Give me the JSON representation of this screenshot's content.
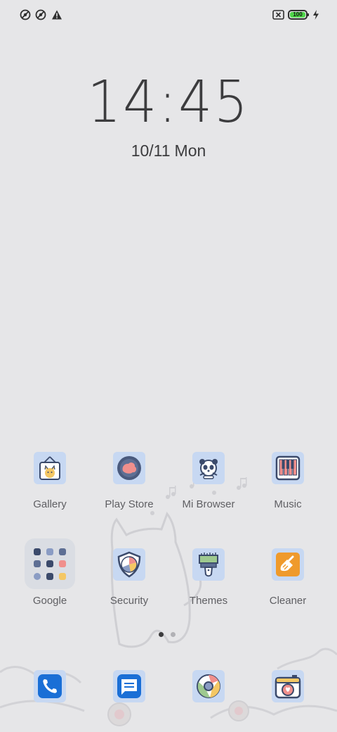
{
  "clock": {
    "time": "14:45"
  },
  "date": {
    "date": "10/11",
    "weekday": "Mon"
  },
  "status_bar": {
    "icons": [
      "no-signal-icon",
      "no-signal-icon",
      "alert-icon",
      "no-sim-icon",
      "battery-icon",
      "charging-icon"
    ],
    "battery_level": "100"
  },
  "apps": [
    {
      "label": "Gallery",
      "icon": "gallery-icon"
    },
    {
      "label": "Play Store",
      "icon": "play-store-icon"
    },
    {
      "label": "Mi Browser",
      "icon": "browser-icon"
    },
    {
      "label": "Music",
      "icon": "music-icon"
    },
    {
      "label": "Google",
      "icon": "folder-icon"
    },
    {
      "label": "Security",
      "icon": "security-icon"
    },
    {
      "label": "Themes",
      "icon": "themes-icon"
    },
    {
      "label": "Cleaner",
      "icon": "cleaner-icon"
    }
  ],
  "dock": [
    {
      "icon": "phone-icon"
    },
    {
      "icon": "messages-icon"
    },
    {
      "icon": "chrome-icon"
    },
    {
      "icon": "camera-icon"
    }
  ],
  "pager": {
    "pages": 2,
    "current": 1
  },
  "colors": {
    "background": "#e6e6e8",
    "tile": "#c7d8f2",
    "icon_blue": "#1a6fd6",
    "label": "#5f5f63",
    "battery": "#4fd64a",
    "cleaner_orange": "#ef9a2c"
  }
}
